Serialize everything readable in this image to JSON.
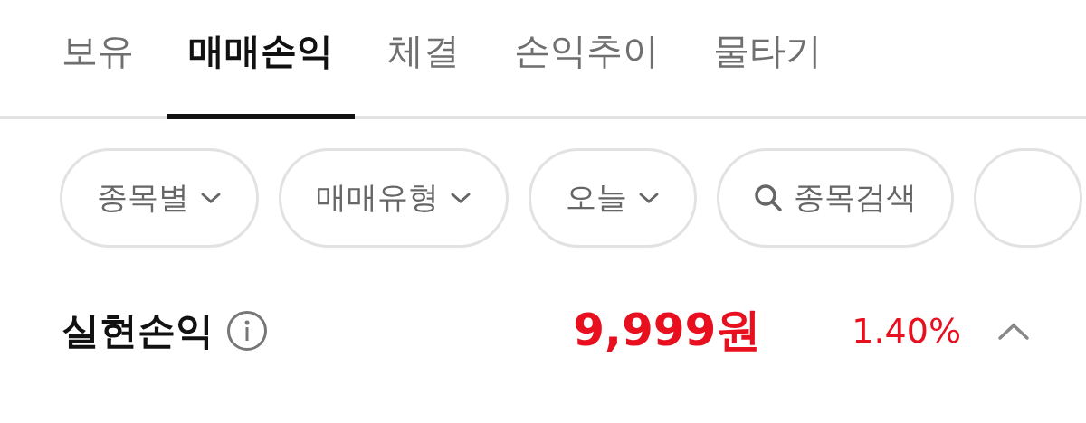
{
  "tabs": [
    {
      "label": "보유",
      "selected": false
    },
    {
      "label": "매매손익",
      "selected": true
    },
    {
      "label": "체결",
      "selected": false
    },
    {
      "label": "손익추이",
      "selected": false
    },
    {
      "label": "물타기",
      "selected": false
    }
  ],
  "filters": [
    {
      "kind": "dropdown",
      "label": "종목별"
    },
    {
      "kind": "dropdown",
      "label": "매매유형"
    },
    {
      "kind": "dropdown",
      "label": "오늘"
    },
    {
      "kind": "search",
      "label": "종목검색"
    },
    {
      "kind": "cut"
    }
  ],
  "summary": {
    "label": "실현손익",
    "amount": "9,999원",
    "rate": "1.40%",
    "expanded": true
  }
}
